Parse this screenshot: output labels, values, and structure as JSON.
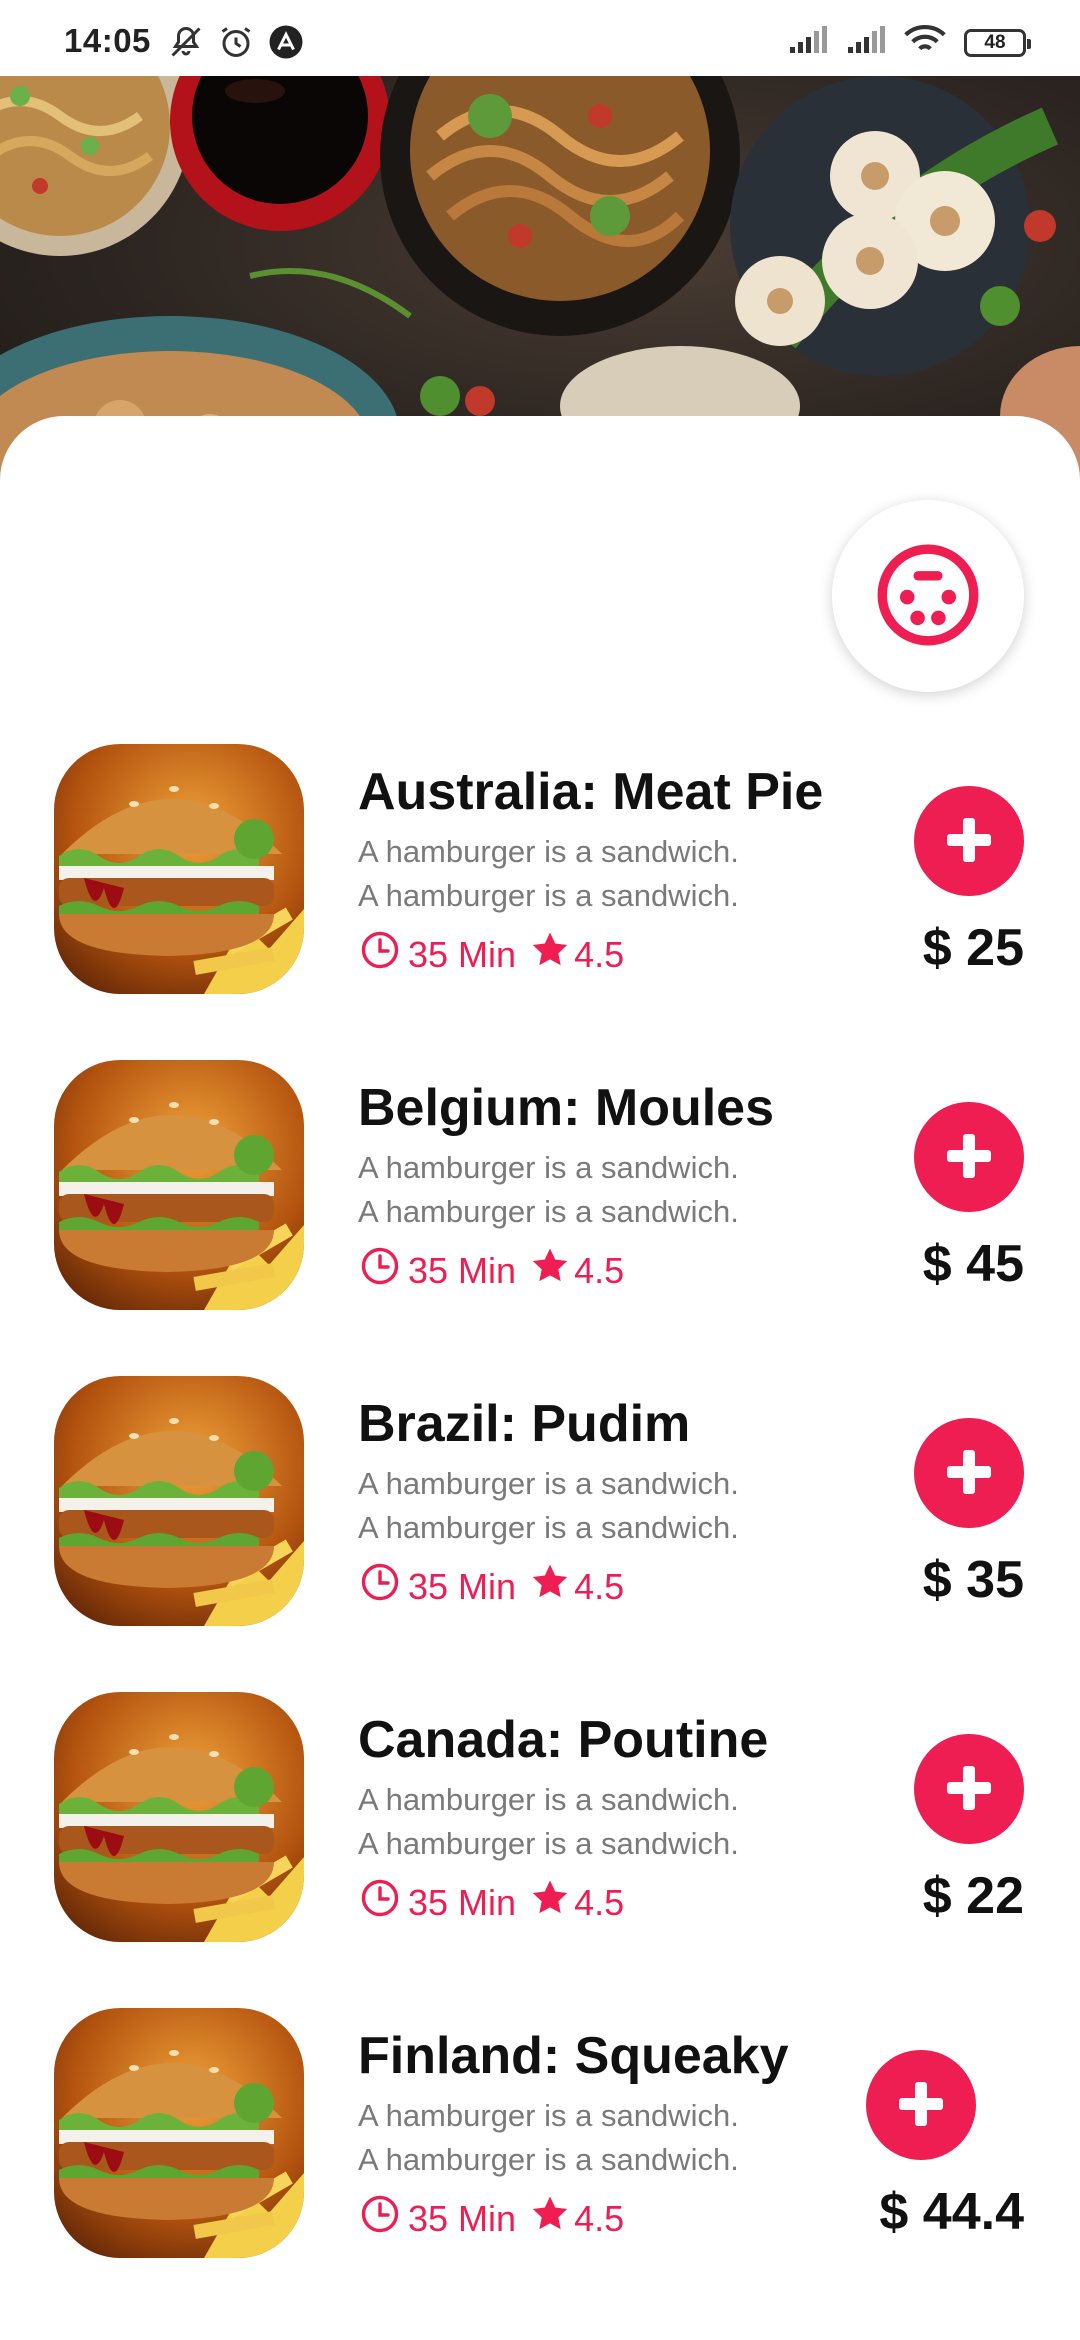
{
  "status_bar": {
    "time": "14:05",
    "battery": "48"
  },
  "colors": {
    "accent": "#ee1d52",
    "text": "#111111",
    "muted": "#7a7a7a"
  },
  "icons": {
    "cuisine": "dining-plate-icon",
    "time": "clock-icon",
    "rating": "star-icon",
    "add": "plus-icon"
  },
  "menu": {
    "items": [
      {
        "name": "Australia: Meat Pie",
        "desc_line1": "A hamburger is a sandwich.",
        "desc_line2": "A hamburger is a sandwich.",
        "time": "35 Min",
        "rating": "4.5",
        "price": "$ 25"
      },
      {
        "name": "Belgium: Moules",
        "desc_line1": "A hamburger is a sandwich.",
        "desc_line2": "A hamburger is a sandwich.",
        "time": "35 Min",
        "rating": "4.5",
        "price": "$ 45"
      },
      {
        "name": "Brazil: Pudim",
        "desc_line1": "A hamburger is a sandwich.",
        "desc_line2": "A hamburger is a sandwich.",
        "time": "35 Min",
        "rating": "4.5",
        "price": "$ 35"
      },
      {
        "name": "Canada: Poutine",
        "desc_line1": "A hamburger is a sandwich.",
        "desc_line2": "A hamburger is a sandwich.",
        "time": "35 Min",
        "rating": "4.5",
        "price": "$ 22"
      },
      {
        "name": "Finland: Squeaky",
        "desc_line1": "A hamburger is a sandwich.",
        "desc_line2": "A hamburger is a sandwich.",
        "time": "35 Min",
        "rating": "4.5",
        "price": "$ 44.4"
      }
    ]
  }
}
